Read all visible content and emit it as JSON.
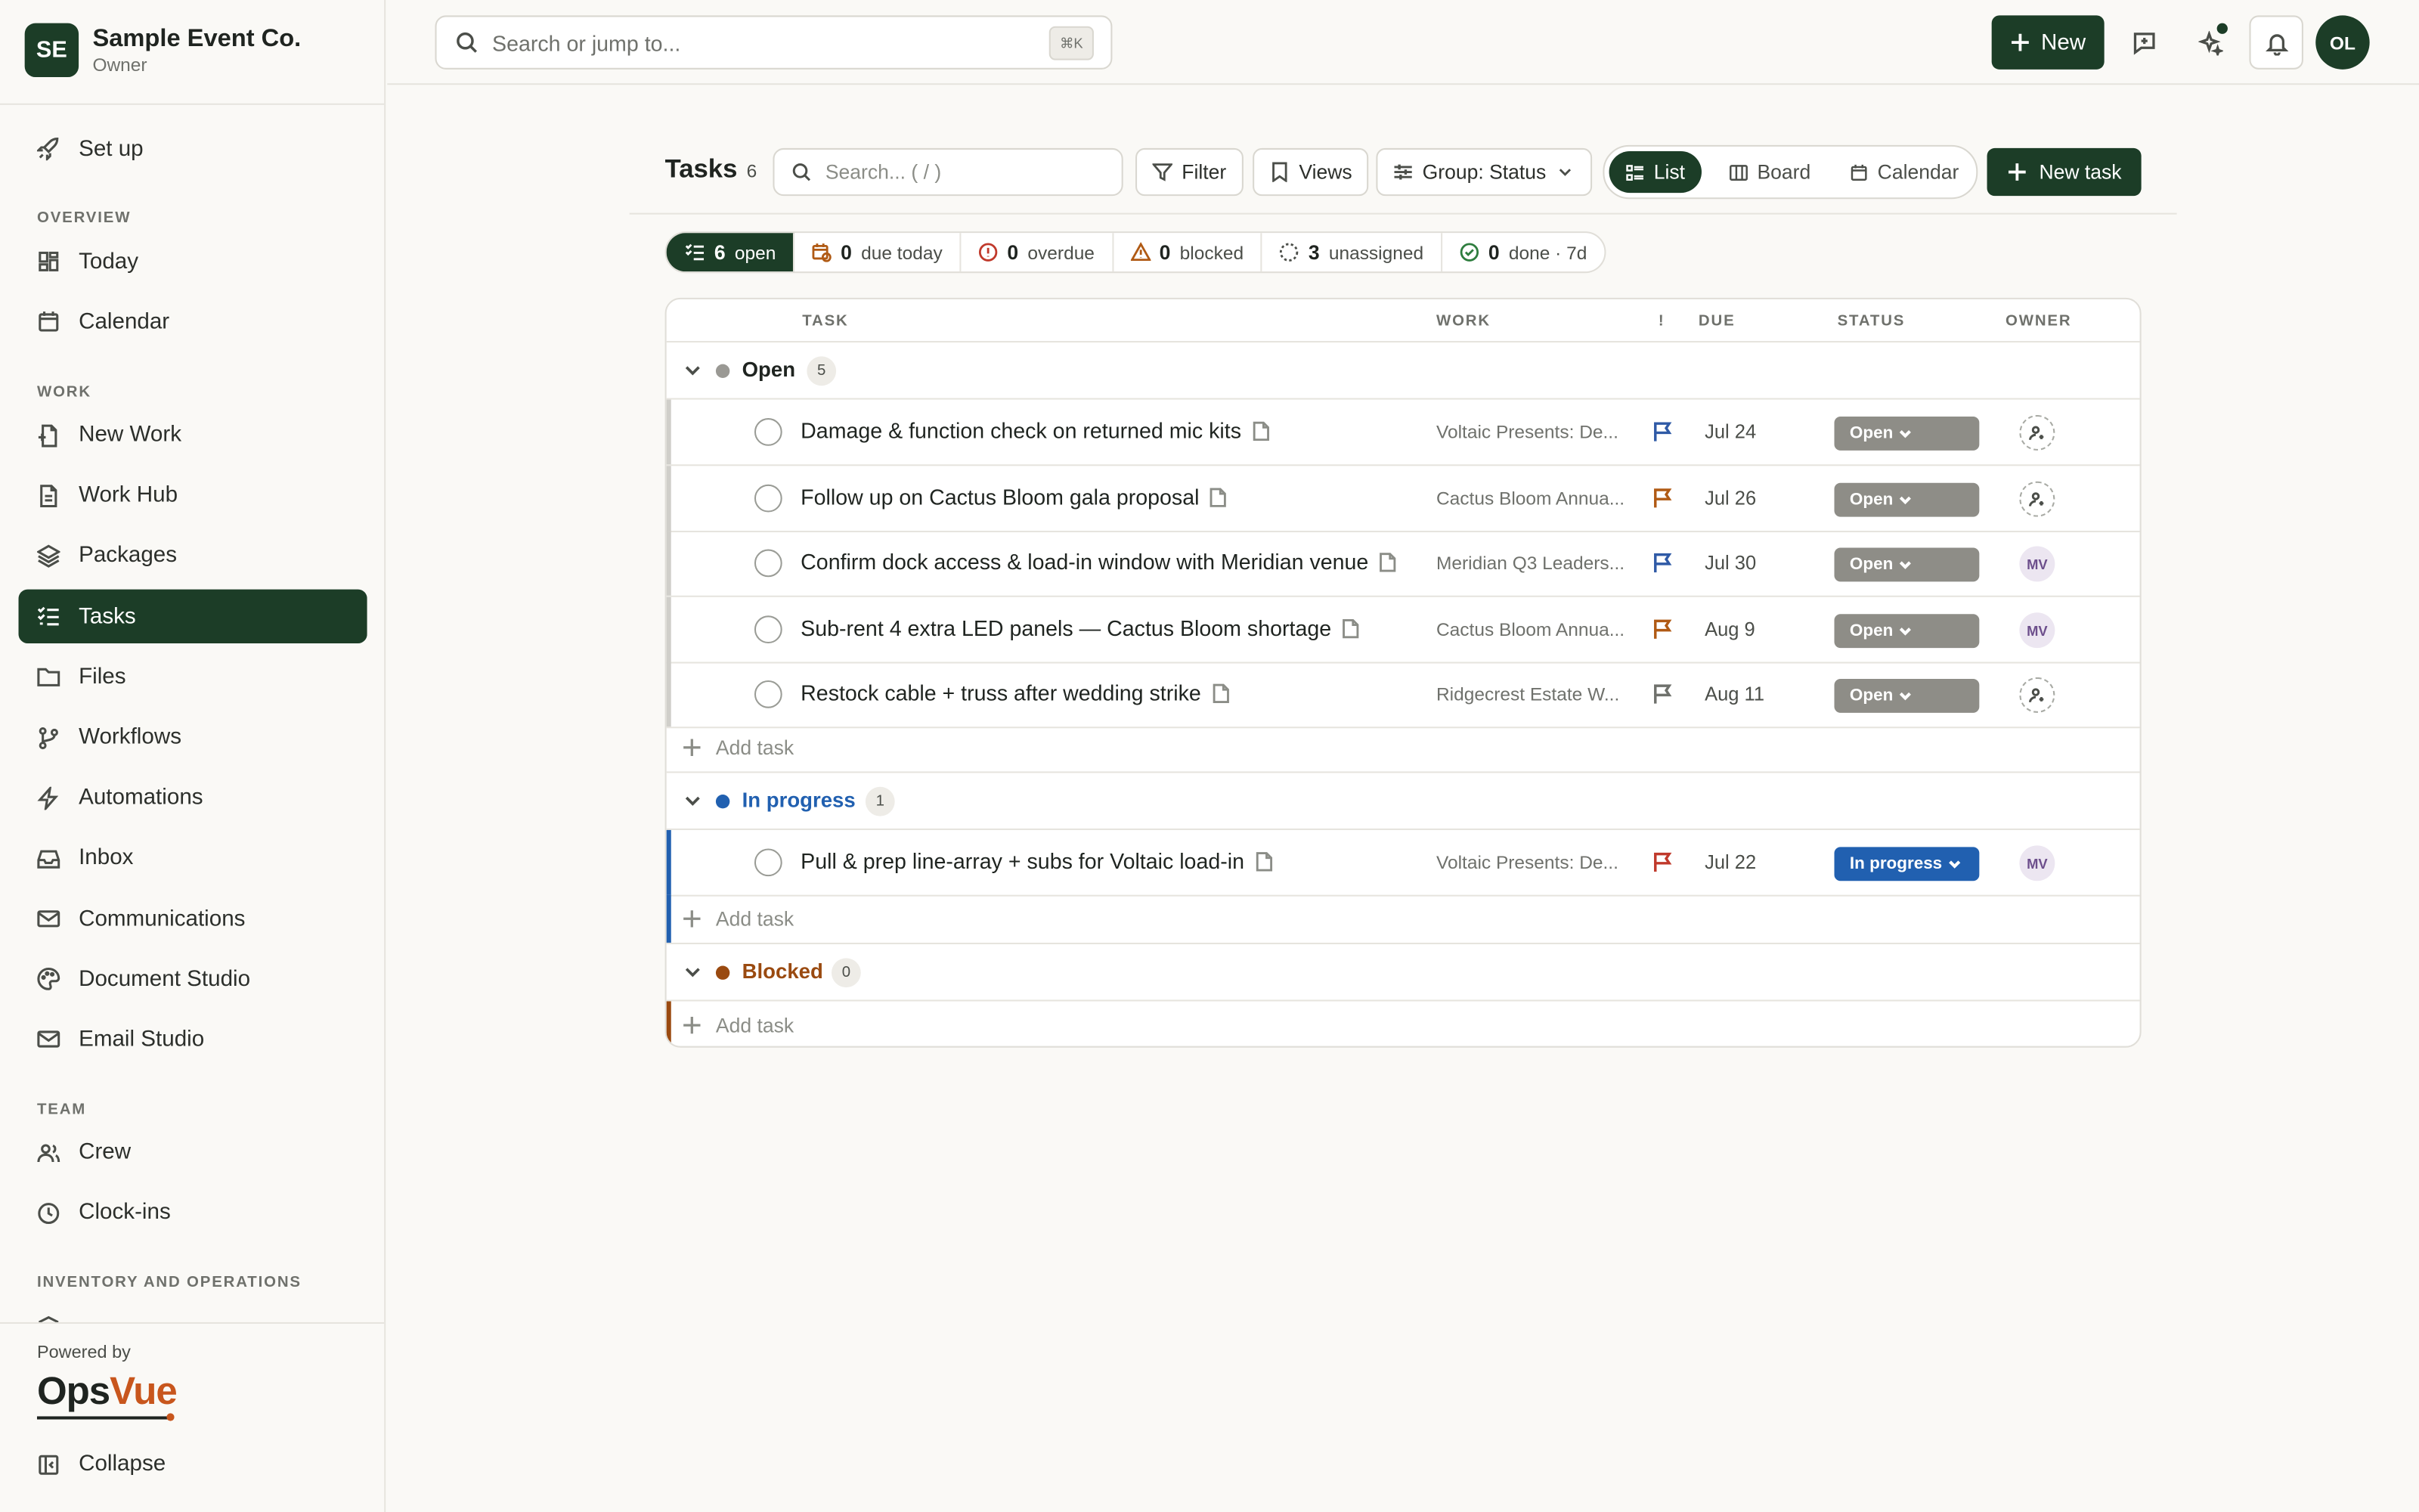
{
  "org": {
    "initials": "SE",
    "name": "Sample Event Co.",
    "role": "Owner"
  },
  "nav": {
    "setup": "Set up",
    "overview_heading": "OVERVIEW",
    "today": "Today",
    "calendar": "Calendar",
    "work_heading": "WORK",
    "new_work": "New Work",
    "work_hub": "Work Hub",
    "packages": "Packages",
    "tasks": "Tasks",
    "files": "Files",
    "workflows": "Workflows",
    "automations": "Automations",
    "inbox": "Inbox",
    "communications": "Communications",
    "document_studio": "Document Studio",
    "email_studio": "Email Studio",
    "team_heading": "TEAM",
    "crew": "Crew",
    "clockins": "Clock-ins",
    "inventory_heading": "INVENTORY AND OPERATIONS"
  },
  "brand": {
    "powered_by": "Powered by",
    "name_a": "Ops",
    "name_b": "Vue",
    "collapse": "Collapse"
  },
  "topbar": {
    "search_placeholder": "Search or jump to...",
    "shortcut": "⌘K",
    "new_label": "New",
    "user_initials": "OL"
  },
  "page": {
    "title": "Tasks",
    "count": "6",
    "search_placeholder": "Search...  ( / )",
    "filter": "Filter",
    "views": "Views",
    "group": "Group: Status",
    "view_list": "List",
    "view_board": "Board",
    "view_calendar": "Calendar",
    "new_task": "New task"
  },
  "stats": [
    {
      "value": "6",
      "label": "open"
    },
    {
      "value": "0",
      "label": "due today"
    },
    {
      "value": "0",
      "label": "overdue"
    },
    {
      "value": "0",
      "label": "blocked"
    },
    {
      "value": "3",
      "label": "unassigned"
    },
    {
      "value": "0",
      "label": "done · 7d"
    }
  ],
  "columns": {
    "task": "TASK",
    "work": "WORK",
    "priority": "!",
    "due": "DUE",
    "status": "STATUS",
    "owner": "OWNER"
  },
  "colors": {
    "accent": "#1c3d27",
    "open": "#8e8d87",
    "in_progress": "#2160b0",
    "blocked": "#9a4a10",
    "flag_blue": "#2f5aa6",
    "flag_orange": "#b05a14"
  },
  "groups": [
    {
      "name": "Open",
      "count": "5",
      "add_label": "Add task",
      "tasks": [
        {
          "name": "Damage & function check on returned mic kits",
          "work": "Voltaic Presents: De...",
          "due": "Jul 24",
          "status": "Open",
          "owner": "",
          "flag": "blue"
        },
        {
          "name": "Follow up on Cactus Bloom gala proposal",
          "work": "Cactus Bloom Annua...",
          "due": "Jul 26",
          "status": "Open",
          "owner": "",
          "flag": "orange"
        },
        {
          "name": "Confirm dock access & load-in window with Meridian venue",
          "work": "Meridian Q3 Leaders...",
          "due": "Jul 30",
          "status": "Open",
          "owner": "MV",
          "flag": "blue"
        },
        {
          "name": "Sub-rent 4 extra LED panels — Cactus Bloom shortage",
          "work": "Cactus Bloom Annua...",
          "due": "Aug 9",
          "status": "Open",
          "owner": "MV",
          "flag": "orange"
        },
        {
          "name": "Restock cable + truss after wedding strike",
          "work": "Ridgecrest Estate W...",
          "due": "Aug 11",
          "status": "Open",
          "owner": "",
          "flag": "gray"
        }
      ]
    },
    {
      "name": "In progress",
      "count": "1",
      "add_label": "Add task",
      "tasks": [
        {
          "name": "Pull & prep line-array + subs for Voltaic load-in",
          "work": "Voltaic Presents: De...",
          "due": "Jul 22",
          "status": "In progress",
          "owner": "MV",
          "flag": "red"
        }
      ]
    },
    {
      "name": "Blocked",
      "count": "0",
      "add_label": "Add task",
      "tasks": []
    }
  ]
}
